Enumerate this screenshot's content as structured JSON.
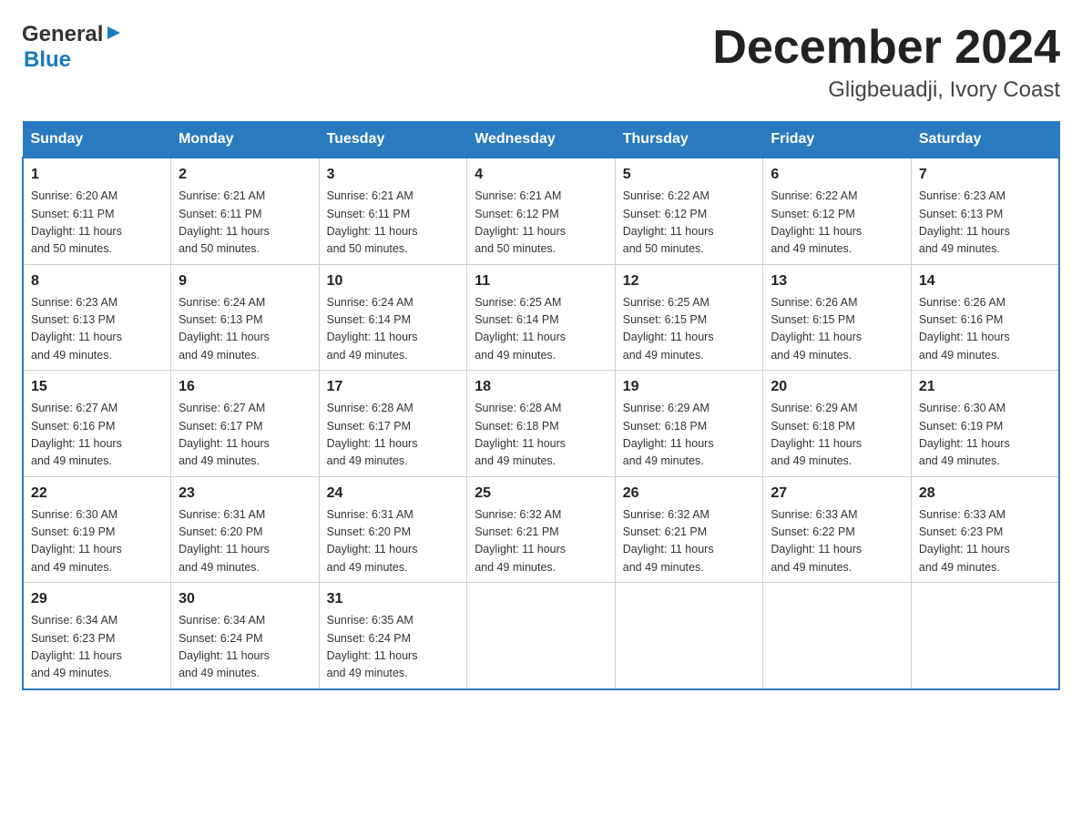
{
  "header": {
    "title": "December 2024",
    "subtitle": "Gligbeuadji, Ivory Coast",
    "logo_general": "General",
    "logo_blue": "Blue"
  },
  "calendar": {
    "days_of_week": [
      "Sunday",
      "Monday",
      "Tuesday",
      "Wednesday",
      "Thursday",
      "Friday",
      "Saturday"
    ],
    "weeks": [
      [
        {
          "day": "1",
          "sunrise": "6:20 AM",
          "sunset": "6:11 PM",
          "daylight": "11 hours and 50 minutes."
        },
        {
          "day": "2",
          "sunrise": "6:21 AM",
          "sunset": "6:11 PM",
          "daylight": "11 hours and 50 minutes."
        },
        {
          "day": "3",
          "sunrise": "6:21 AM",
          "sunset": "6:11 PM",
          "daylight": "11 hours and 50 minutes."
        },
        {
          "day": "4",
          "sunrise": "6:21 AM",
          "sunset": "6:12 PM",
          "daylight": "11 hours and 50 minutes."
        },
        {
          "day": "5",
          "sunrise": "6:22 AM",
          "sunset": "6:12 PM",
          "daylight": "11 hours and 50 minutes."
        },
        {
          "day": "6",
          "sunrise": "6:22 AM",
          "sunset": "6:12 PM",
          "daylight": "11 hours and 49 minutes."
        },
        {
          "day": "7",
          "sunrise": "6:23 AM",
          "sunset": "6:13 PM",
          "daylight": "11 hours and 49 minutes."
        }
      ],
      [
        {
          "day": "8",
          "sunrise": "6:23 AM",
          "sunset": "6:13 PM",
          "daylight": "11 hours and 49 minutes."
        },
        {
          "day": "9",
          "sunrise": "6:24 AM",
          "sunset": "6:13 PM",
          "daylight": "11 hours and 49 minutes."
        },
        {
          "day": "10",
          "sunrise": "6:24 AM",
          "sunset": "6:14 PM",
          "daylight": "11 hours and 49 minutes."
        },
        {
          "day": "11",
          "sunrise": "6:25 AM",
          "sunset": "6:14 PM",
          "daylight": "11 hours and 49 minutes."
        },
        {
          "day": "12",
          "sunrise": "6:25 AM",
          "sunset": "6:15 PM",
          "daylight": "11 hours and 49 minutes."
        },
        {
          "day": "13",
          "sunrise": "6:26 AM",
          "sunset": "6:15 PM",
          "daylight": "11 hours and 49 minutes."
        },
        {
          "day": "14",
          "sunrise": "6:26 AM",
          "sunset": "6:16 PM",
          "daylight": "11 hours and 49 minutes."
        }
      ],
      [
        {
          "day": "15",
          "sunrise": "6:27 AM",
          "sunset": "6:16 PM",
          "daylight": "11 hours and 49 minutes."
        },
        {
          "day": "16",
          "sunrise": "6:27 AM",
          "sunset": "6:17 PM",
          "daylight": "11 hours and 49 minutes."
        },
        {
          "day": "17",
          "sunrise": "6:28 AM",
          "sunset": "6:17 PM",
          "daylight": "11 hours and 49 minutes."
        },
        {
          "day": "18",
          "sunrise": "6:28 AM",
          "sunset": "6:18 PM",
          "daylight": "11 hours and 49 minutes."
        },
        {
          "day": "19",
          "sunrise": "6:29 AM",
          "sunset": "6:18 PM",
          "daylight": "11 hours and 49 minutes."
        },
        {
          "day": "20",
          "sunrise": "6:29 AM",
          "sunset": "6:18 PM",
          "daylight": "11 hours and 49 minutes."
        },
        {
          "day": "21",
          "sunrise": "6:30 AM",
          "sunset": "6:19 PM",
          "daylight": "11 hours and 49 minutes."
        }
      ],
      [
        {
          "day": "22",
          "sunrise": "6:30 AM",
          "sunset": "6:19 PM",
          "daylight": "11 hours and 49 minutes."
        },
        {
          "day": "23",
          "sunrise": "6:31 AM",
          "sunset": "6:20 PM",
          "daylight": "11 hours and 49 minutes."
        },
        {
          "day": "24",
          "sunrise": "6:31 AM",
          "sunset": "6:20 PM",
          "daylight": "11 hours and 49 minutes."
        },
        {
          "day": "25",
          "sunrise": "6:32 AM",
          "sunset": "6:21 PM",
          "daylight": "11 hours and 49 minutes."
        },
        {
          "day": "26",
          "sunrise": "6:32 AM",
          "sunset": "6:21 PM",
          "daylight": "11 hours and 49 minutes."
        },
        {
          "day": "27",
          "sunrise": "6:33 AM",
          "sunset": "6:22 PM",
          "daylight": "11 hours and 49 minutes."
        },
        {
          "day": "28",
          "sunrise": "6:33 AM",
          "sunset": "6:23 PM",
          "daylight": "11 hours and 49 minutes."
        }
      ],
      [
        {
          "day": "29",
          "sunrise": "6:34 AM",
          "sunset": "6:23 PM",
          "daylight": "11 hours and 49 minutes."
        },
        {
          "day": "30",
          "sunrise": "6:34 AM",
          "sunset": "6:24 PM",
          "daylight": "11 hours and 49 minutes."
        },
        {
          "day": "31",
          "sunrise": "6:35 AM",
          "sunset": "6:24 PM",
          "daylight": "11 hours and 49 minutes."
        },
        {
          "day": "",
          "sunrise": "",
          "sunset": "",
          "daylight": ""
        },
        {
          "day": "",
          "sunrise": "",
          "sunset": "",
          "daylight": ""
        },
        {
          "day": "",
          "sunrise": "",
          "sunset": "",
          "daylight": ""
        },
        {
          "day": "",
          "sunrise": "",
          "sunset": "",
          "daylight": ""
        }
      ]
    ],
    "labels": {
      "sunrise": "Sunrise:",
      "sunset": "Sunset:",
      "daylight": "Daylight:"
    }
  }
}
